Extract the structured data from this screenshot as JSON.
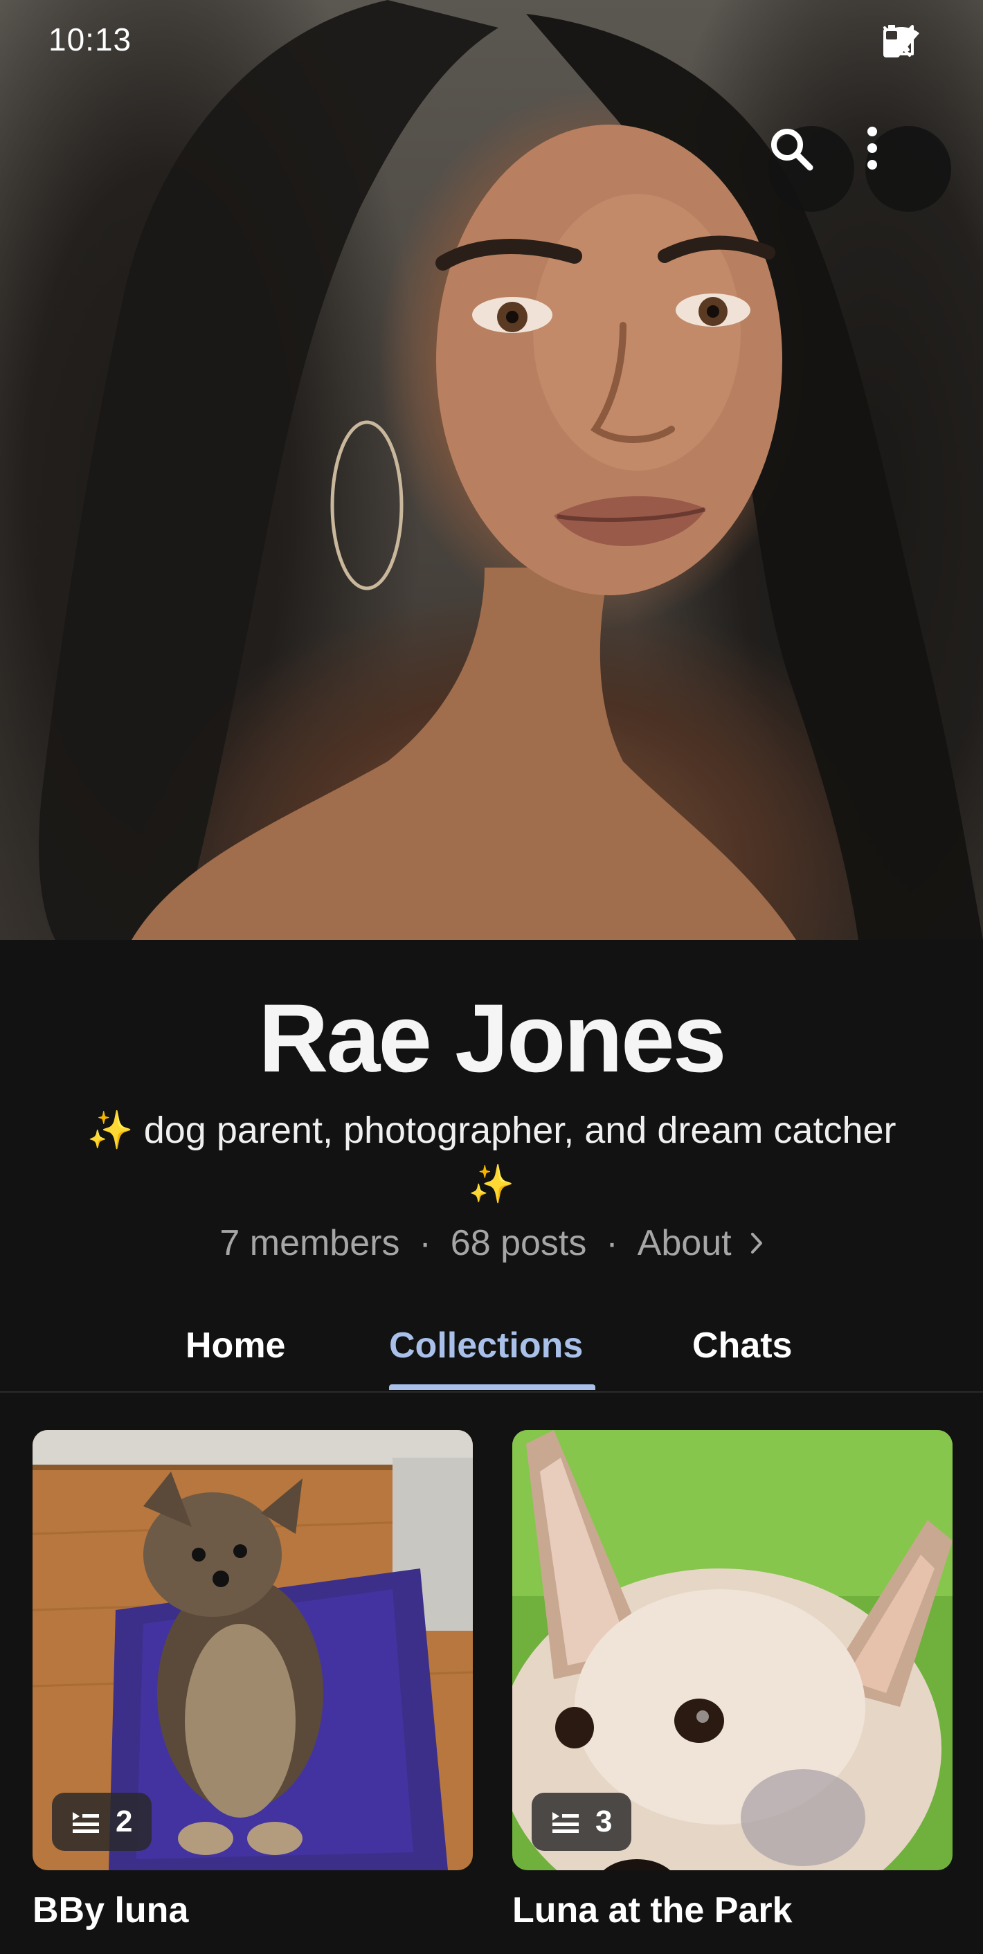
{
  "status_bar": {
    "time": "10:13",
    "icons": [
      "bell-off-icon",
      "wifi-icon",
      "signal-icon",
      "battery-icon"
    ]
  },
  "header": {
    "search_icon": "search-icon",
    "more_icon": "more-vertical-icon"
  },
  "profile": {
    "name": "Rae Jones",
    "bio": "✨ dog parent, photographer, and dream catcher ✨",
    "members": "7 members",
    "posts": "68 posts",
    "separator": "·",
    "about": "About",
    "about_icon": "chevron-right-icon"
  },
  "tabs": [
    {
      "label": "Home",
      "selected": false
    },
    {
      "label": "Collections",
      "selected": true
    },
    {
      "label": "Chats",
      "selected": false
    }
  ],
  "collections": [
    {
      "title": "BBy luna",
      "count": "2",
      "count_icon": "list-icon"
    },
    {
      "title": "Luna at the Park",
      "count": "3",
      "count_icon": "list-icon"
    }
  ],
  "colors": {
    "background": "#121212",
    "accent": "#a9c1ea",
    "muted_text": "#a6a6a6"
  }
}
